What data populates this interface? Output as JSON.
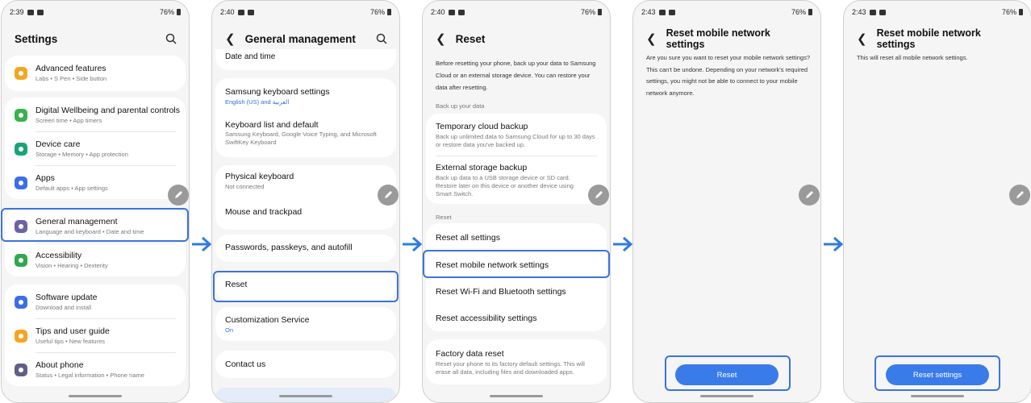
{
  "colors": {
    "accent": "#3a7bea",
    "highlight": "#3b74d9",
    "arrow": "#2e7be3"
  },
  "screens": [
    {
      "status": {
        "time": "2:39",
        "battery": "76%"
      },
      "title": "Settings",
      "items": [
        {
          "label": "Advanced features",
          "sub": "Labs • S Pen • Side button",
          "icon": "star-icon",
          "color": "#f4a623"
        },
        {
          "label": "Digital Wellbeing and parental controls",
          "sub": "Screen time • App timers",
          "icon": "wellbeing-icon",
          "color": "#37b24d"
        },
        {
          "label": "Device care",
          "sub": "Storage • Memory • App protection",
          "icon": "device-care-icon",
          "color": "#1aa37a"
        },
        {
          "label": "Apps",
          "sub": "Default apps • App settings",
          "icon": "apps-icon",
          "color": "#3d6ee8"
        },
        {
          "label": "General management",
          "sub": "Language and keyboard • Date and time",
          "icon": "general-management-icon",
          "color": "#6b63a8"
        },
        {
          "label": "Accessibility",
          "sub": "Vision • Hearing • Dexterity",
          "icon": "accessibility-icon",
          "color": "#2fa84f"
        },
        {
          "label": "Software update",
          "sub": "Download and install",
          "icon": "software-update-icon",
          "color": "#3d6ee8"
        },
        {
          "label": "Tips and user guide",
          "sub": "Useful tips • New features",
          "icon": "tips-icon",
          "color": "#f4a623"
        },
        {
          "label": "About phone",
          "sub": "Status • Legal information • Phone name",
          "icon": "about-phone-icon",
          "color": "#5f5f8a"
        }
      ]
    },
    {
      "status": {
        "time": "2:40",
        "battery": "76%"
      },
      "title": "General management",
      "items": [
        {
          "label": "Date and time"
        },
        {
          "label": "Samsung keyboard settings",
          "sub": "English (US) and العربية"
        },
        {
          "label": "Keyboard list and default",
          "sub": "Samsung Keyboard, Google Voice Typing, and Microsoft SwiftKey Keyboard"
        },
        {
          "label": "Physical keyboard",
          "sub": "Not connected"
        },
        {
          "label": "Mouse and trackpad"
        },
        {
          "label": "Passwords, passkeys, and autofill"
        },
        {
          "label": "Reset"
        },
        {
          "label": "Customization Service",
          "sub": "On"
        },
        {
          "label": "Contact us"
        }
      ]
    },
    {
      "status": {
        "time": "2:40",
        "battery": "76%"
      },
      "title": "Reset",
      "intro": "Before resetting your phone, back up your data to Samsung Cloud or an external storage device. You can restore your data after resetting.",
      "section_backup": "Back up your data",
      "backup": [
        {
          "label": "Temporary cloud backup",
          "sub": "Back up unlimited data to Samsung Cloud for up to 30 days or restore data you've backed up."
        },
        {
          "label": "External storage backup",
          "sub": "Back up data to a USB storage device or SD card. Restore later on this device or another device using Smart Switch."
        }
      ],
      "section_reset": "Reset",
      "reset": [
        {
          "label": "Reset all settings"
        },
        {
          "label": "Reset mobile network settings"
        },
        {
          "label": "Reset Wi-Fi and Bluetooth settings"
        },
        {
          "label": "Reset accessibility settings"
        }
      ],
      "factory": {
        "label": "Factory data reset",
        "sub": "Reset your phone to its factory default settings. This will erase all data, including files and downloaded apps."
      }
    },
    {
      "status": {
        "time": "2:43",
        "battery": "76%"
      },
      "title": "Reset mobile network settings",
      "body": "Are you sure you want to reset your mobile network settings? This can't be undone. Depending on your network's required settings, you might not be able to connect to your mobile network anymore.",
      "button": "Reset"
    },
    {
      "status": {
        "time": "2:43",
        "battery": "76%"
      },
      "title": "Reset mobile network settings",
      "body": "This will reset all mobile network settings.",
      "button": "Reset settings"
    }
  ]
}
